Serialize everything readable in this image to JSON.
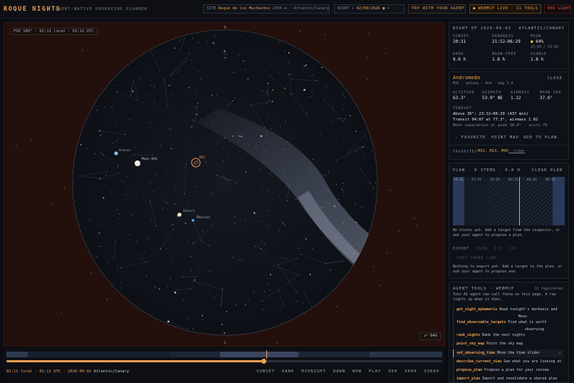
{
  "app": {
    "title": "ROQUE NIGHTS",
    "tagline": "AGENT-NATIVE OBSERVING PLANNER"
  },
  "topbar": {
    "site_label": "SITE",
    "site_name": "Roque de los Muchachos",
    "site_elev": "2396 m · Atlantic/Canary",
    "night_label": "NIGHT",
    "night_date": "02/09/2026",
    "try_agent": "TRY WITH YOUR AGENT",
    "webmcp": "● WEBMCP LIVE · 11 TOOLS",
    "red_light": "RED LIGHT"
  },
  "sky": {
    "fov_label": "FOV 186° · 02:11 local · 01:11 UTC",
    "zoom_button": "⤺ 64%",
    "labels": {
      "moon": "Moon 64%",
      "uranus": "Uranus",
      "saturn": "Saturn",
      "neptune": "Neptune",
      "m31": "M31"
    },
    "compass": {
      "n": "N",
      "s": "S"
    }
  },
  "timeline": {
    "time_text": "02:11 local · 01:11 UTC · 2026-09-02",
    "timezone": "Atlantic/Canary",
    "progress": 0.59,
    "controls": [
      "SUNSET",
      "DARK",
      "MIDNIGHT",
      "DAWN",
      "NOW",
      "PLAY",
      "X60",
      "X600",
      "X3600"
    ]
  },
  "night_panel": {
    "header": "NIGHT OF 2026-09-02",
    "timezone": "ATLANTIC/CANARY",
    "sunset_label": "SUNSET",
    "sunset": "20:31",
    "darkness_label": "DARKNESS",
    "darkness": "21:52–06:29",
    "moon_label": "MOON",
    "moon_pct": "64%",
    "moon_times": "23:43 / 13:02",
    "dark_label": "DARK",
    "dark": "8.6 h",
    "moonfree_label": "MOON-FREE",
    "moonfree": "1.8 h",
    "usable_label": "USABLE",
    "usable": "1.8 h"
  },
  "target_panel": {
    "name": "Andromeda",
    "subtitle": "M31 · galaxy · And · mag 3.4",
    "close": "CLOSE",
    "altitude_label": "ALTITUDE",
    "altitude": "63.3°",
    "azimuth_label": "AZIMUTH",
    "azimuth": "53.9° NE",
    "airmass_label": "AIRMASS",
    "airmass": "1.12",
    "moonsep_label": "MOON SEP",
    "moonsep": "37.6°",
    "tonight_label": "TONIGHT",
    "tonight_line1": "Above 30°: 23:12–06:29 (437 min)",
    "tonight_line2": "Transit 04:07 at 77.3°, airmass 1.02",
    "tonight_line3": "Moon separation at peak 38.0° · score 79",
    "favorite": "☆ FAVORITE",
    "point_map": "POINT MAP",
    "add_plan": "ADD TO PLAN",
    "favorites_label": "FAVORITES",
    "favorites": "M31, M13, M45",
    "clear": "· clear"
  },
  "plan_panel": {
    "header": "PLAN · 0 ITEMS · 0.0 H",
    "clear": "CLEAR PLAN",
    "hours": [
      "19:31",
      "21:31",
      "23:31",
      "01:31",
      "03:31",
      "05:31"
    ],
    "now_position": 0.59,
    "empty_text_1": "No blocks yet. Add a target from the inspector, or",
    "empty_text_2": "ask your agent to propose a plan.",
    "export_label": "EXPORT",
    "export_json": "JSON",
    "export_ics": "ICS",
    "export_csv": "CSV",
    "copy_link": "COPY SHARE LINK",
    "export_text_1": "Nothing to export yet. Add a target to the plan, or",
    "export_text_2": "ask your agent to propose one."
  },
  "tools_panel": {
    "header": "AGENT TOOLS · WEBMCP",
    "count": "11 registered",
    "intro_1": "Your AI agent can call these on this page. A row",
    "intro_2": "lights up when it does.",
    "tools": [
      {
        "name": "get_night_ephemeris",
        "desc": "Read tonight's darkness and",
        "desc2": "Moon",
        "active": false
      },
      {
        "name": "find_observable_targets",
        "desc": "Find what is worth",
        "desc2": "observing",
        "active": false
      },
      {
        "name": "rank_nights",
        "desc": "Rank the next nights",
        "desc2": "",
        "active": false
      },
      {
        "name": "point_sky_map",
        "desc": "Point the sky map",
        "desc2": "",
        "active": false
      },
      {
        "name": "set_observing_time",
        "desc": "Move the time slider",
        "desc2": "",
        "active": true
      },
      {
        "name": "describe_current_view",
        "desc": "See what you are looking at",
        "desc2": "",
        "active": false
      },
      {
        "name": "propose_plan",
        "desc": "Propose a plan for your review",
        "desc2": "",
        "active": false
      },
      {
        "name": "import_plan",
        "desc": "Import and revalidate a shared plan",
        "desc2": "",
        "active": false
      }
    ],
    "check": "✓"
  },
  "colors": {
    "accent": "#f0a050",
    "red_light": "#ff4a3a",
    "sky_bg": "#0f1218",
    "horizon_bg": "#230f0b"
  }
}
